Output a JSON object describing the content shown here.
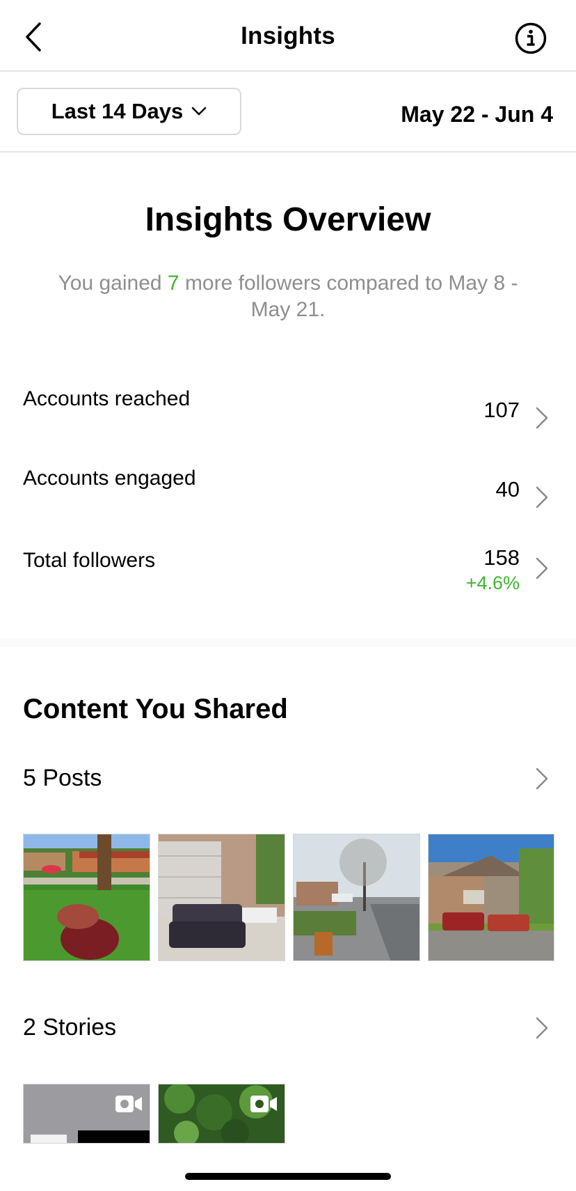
{
  "header": {
    "title": "Insights"
  },
  "filter": {
    "period_label": "Last 14 Days",
    "date_range": "May 22 - Jun 4"
  },
  "overview": {
    "title": "Insights Overview",
    "summary_before": "You gained ",
    "summary_gain": "7",
    "summary_after": " more followers compared to May 8 - May 21."
  },
  "metrics": [
    {
      "label": "Accounts reached",
      "value": "107"
    },
    {
      "label": "Accounts engaged",
      "value": "40"
    },
    {
      "label": "Total followers",
      "value": "158",
      "change": "+4.6%"
    }
  ],
  "content": {
    "title": "Content You Shared",
    "posts_label": "5 Posts",
    "stories_label": "2 Stories"
  },
  "colors": {
    "positive": "#3fb530",
    "muted_text": "#8e8e8e",
    "divider": "#e6e6e6"
  },
  "icons": {
    "back": "chevron-left-icon",
    "info": "info-icon",
    "dropdown": "chevron-down-icon",
    "row_arrow": "chevron-right-icon",
    "story_type": "video-camera-icon"
  }
}
